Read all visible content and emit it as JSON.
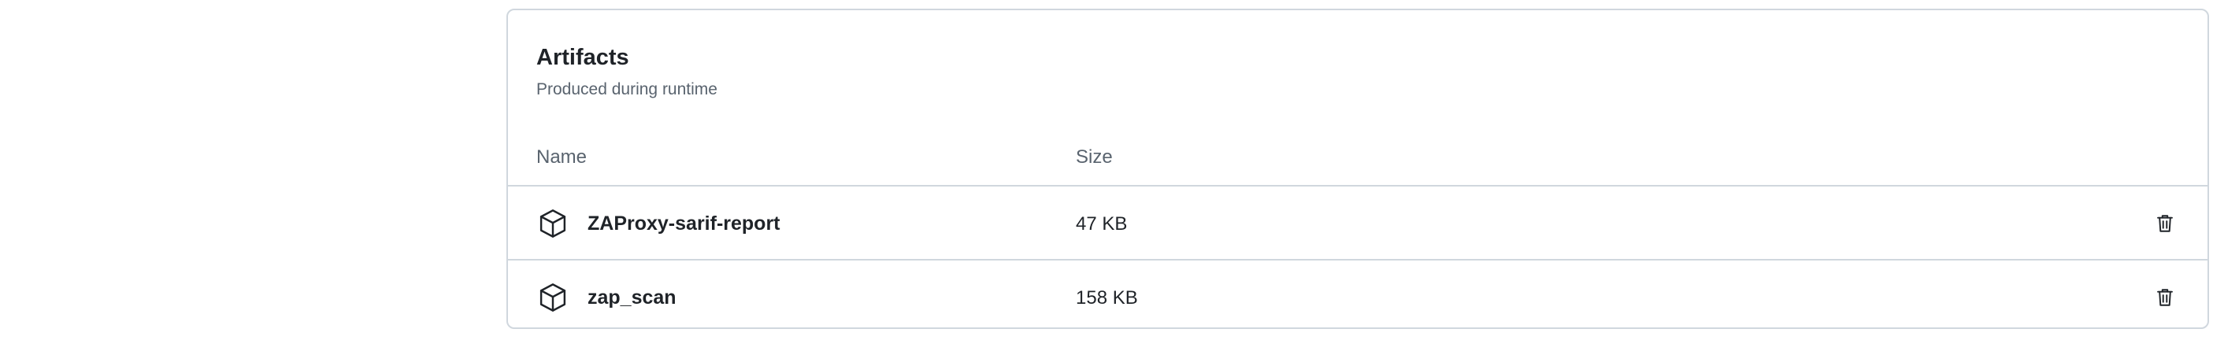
{
  "artifacts": {
    "title": "Artifacts",
    "subtitle": "Produced during runtime",
    "columns": {
      "name": "Name",
      "size": "Size"
    },
    "items": [
      {
        "name": "ZAProxy-sarif-report",
        "size": "47 KB",
        "icon": "package-icon",
        "action_icon": "trash-icon"
      },
      {
        "name": "zap_scan",
        "size": "158 KB",
        "icon": "package-icon",
        "action_icon": "trash-icon"
      }
    ]
  },
  "colors": {
    "border": "#d0d7de",
    "text_primary": "#1f2328",
    "text_muted": "#59636e"
  }
}
